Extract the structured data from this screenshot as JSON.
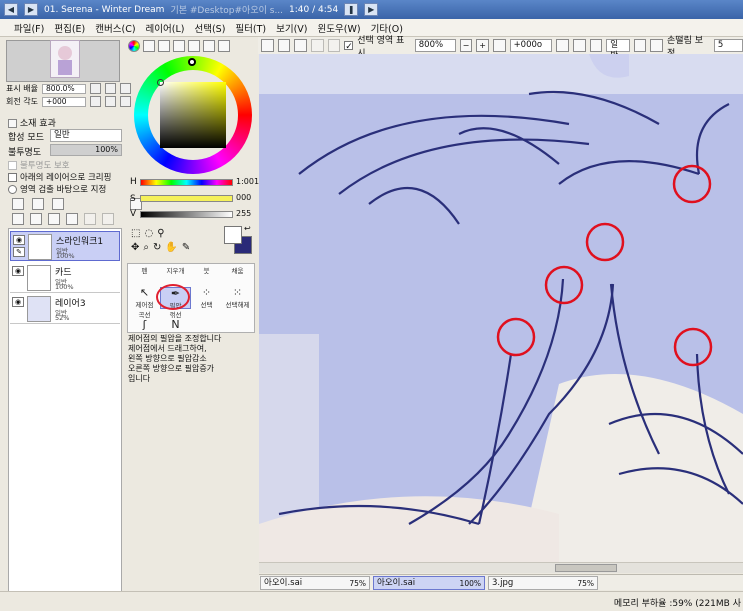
{
  "window": {
    "title": "01. Serena - Winter Dream",
    "path_fragment": "기본 #Desktop#아오이 s...",
    "time": "1:40 / 4:54"
  },
  "menu": [
    "파일(F)",
    "편집(E)",
    "캔버스(C)",
    "레이어(L)",
    "선택(S)",
    "필터(T)",
    "보기(V)",
    "윈도우(W)",
    "기타(O)"
  ],
  "navigator": {
    "zoom_label": "표시 배율",
    "zoom_value": "800.0%",
    "rotate_label": "회전 각도",
    "rotate_value": "+000"
  },
  "layer_props": {
    "effect_label": "소재 효과",
    "blend_label": "합성 모드",
    "blend_value": "일반",
    "opacity_label": "불투명도",
    "opacity_value": "100%",
    "protect_opacity": "불투명도 보호",
    "clip_lower": "아래의 레이어으로 크리핑",
    "select_source": "영역 검출 바탕으로 지정"
  },
  "layers": [
    {
      "name": "스라인워크1",
      "mode": "일반",
      "opacity": "100%",
      "selected": true
    },
    {
      "name": "카드",
      "mode": "일반",
      "opacity": "100%",
      "selected": false
    },
    {
      "name": "레이어3",
      "mode": "일반",
      "opacity": "52%",
      "selected": false
    }
  ],
  "color": {
    "h_label": "H",
    "h_value": "1:001",
    "s_label": "S",
    "s_value": "000",
    "v_label": "V",
    "v_value": "255",
    "fg": "#ffffff",
    "bg": "#2a2a78"
  },
  "tools": {
    "row1": [
      "펜",
      "지우개",
      "붓",
      "채움"
    ],
    "row2": [
      "제어점",
      "필압",
      "선택",
      "선택해제"
    ],
    "row3": [
      "곡선",
      "꺾선"
    ],
    "active": "필압"
  },
  "tool_description": "제어점의 필압을 조정합니다\n제어점에서 드래그하여,\n 왼쪽 방향으로 필압감소\n 오른쪽 방향으로 필압증가\n입니다",
  "toolbar": {
    "select_area_label": "선택 영역 표시",
    "zoom": "800%",
    "angle": "+000o",
    "mode": "일반",
    "stabilizer_label": "손떨림 보정",
    "stabilizer_value": "5"
  },
  "tabs": [
    {
      "name": "아오이.sai",
      "pct": "75%",
      "active": false
    },
    {
      "name": "아오이.sai",
      "pct": "100%",
      "active": true
    },
    {
      "name": "3.jpg",
      "pct": "75%",
      "active": false
    }
  ],
  "status": {
    "memory": "메모리 부하율 :59% (221MB 사"
  }
}
